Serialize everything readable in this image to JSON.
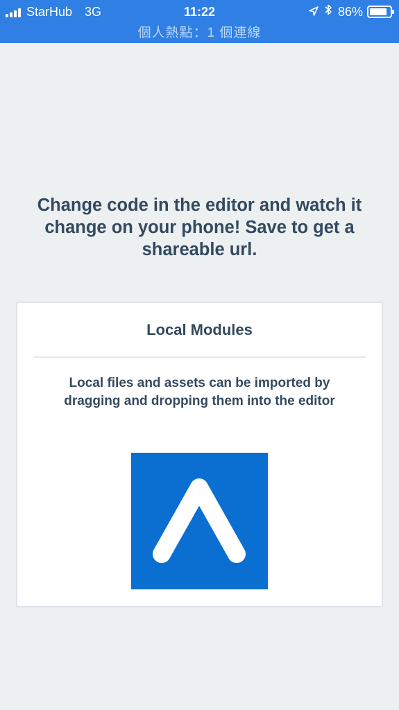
{
  "status_bar": {
    "carrier": "StarHub",
    "network": "3G",
    "time": "11:22",
    "battery_percent": "86%",
    "battery_level": 0.86,
    "hotspot_text": "個人熱點：1 個連線",
    "icons": [
      "signal-bars-icon",
      "location-arrow-icon",
      "bluetooth-icon",
      "battery-icon"
    ],
    "color": "#2f7fe4"
  },
  "main": {
    "intro_text": "Change code in the editor and watch it change on your phone! Save to get a shareable url."
  },
  "card": {
    "title": "Local Modules",
    "body": "Local files and assets can be imported by dragging and dropping them into the editor",
    "logo_icon": "expo-logo-icon",
    "logo_color": "#0a6fd0"
  },
  "colors": {
    "background": "#ecf0f1",
    "text": "#34495e",
    "card_background": "#ffffff"
  }
}
